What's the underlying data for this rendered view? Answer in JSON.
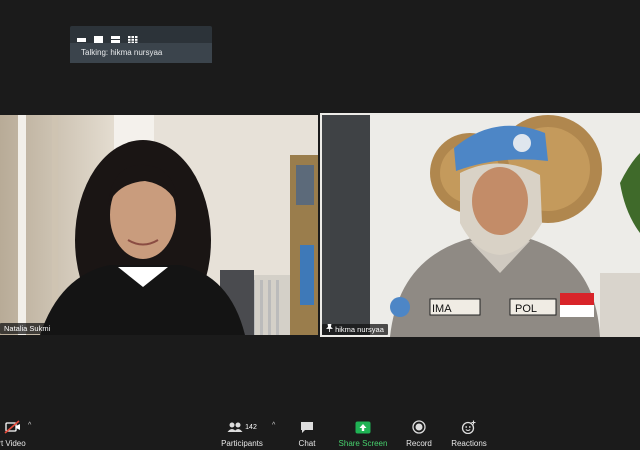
{
  "talking": {
    "label": "Talking: hikma nursyaa"
  },
  "participants_tiles": [
    {
      "name": "Natalia Sukmi"
    },
    {
      "name": "hikma nursyaa"
    }
  ],
  "toolbar": {
    "video_label": "rt Video",
    "participants_label": "Participants",
    "participants_count": "142",
    "chat_label": "Chat",
    "share_label": "Share Screen",
    "record_label": "Record",
    "reactions_label": "Reactions"
  },
  "colors": {
    "active_speaker_border": "#c9e04a",
    "share_green": "#47d16d",
    "accent_blue": "#2d8cff"
  },
  "icons": {
    "view": [
      "active-speaker-view-icon",
      "thumbnail-view-icon",
      "gallery-2-view-icon",
      "gallery-view-icon"
    ],
    "toolbar": [
      "video-off-icon",
      "participants-icon",
      "chat-icon",
      "share-screen-icon",
      "record-icon",
      "reactions-icon"
    ]
  }
}
